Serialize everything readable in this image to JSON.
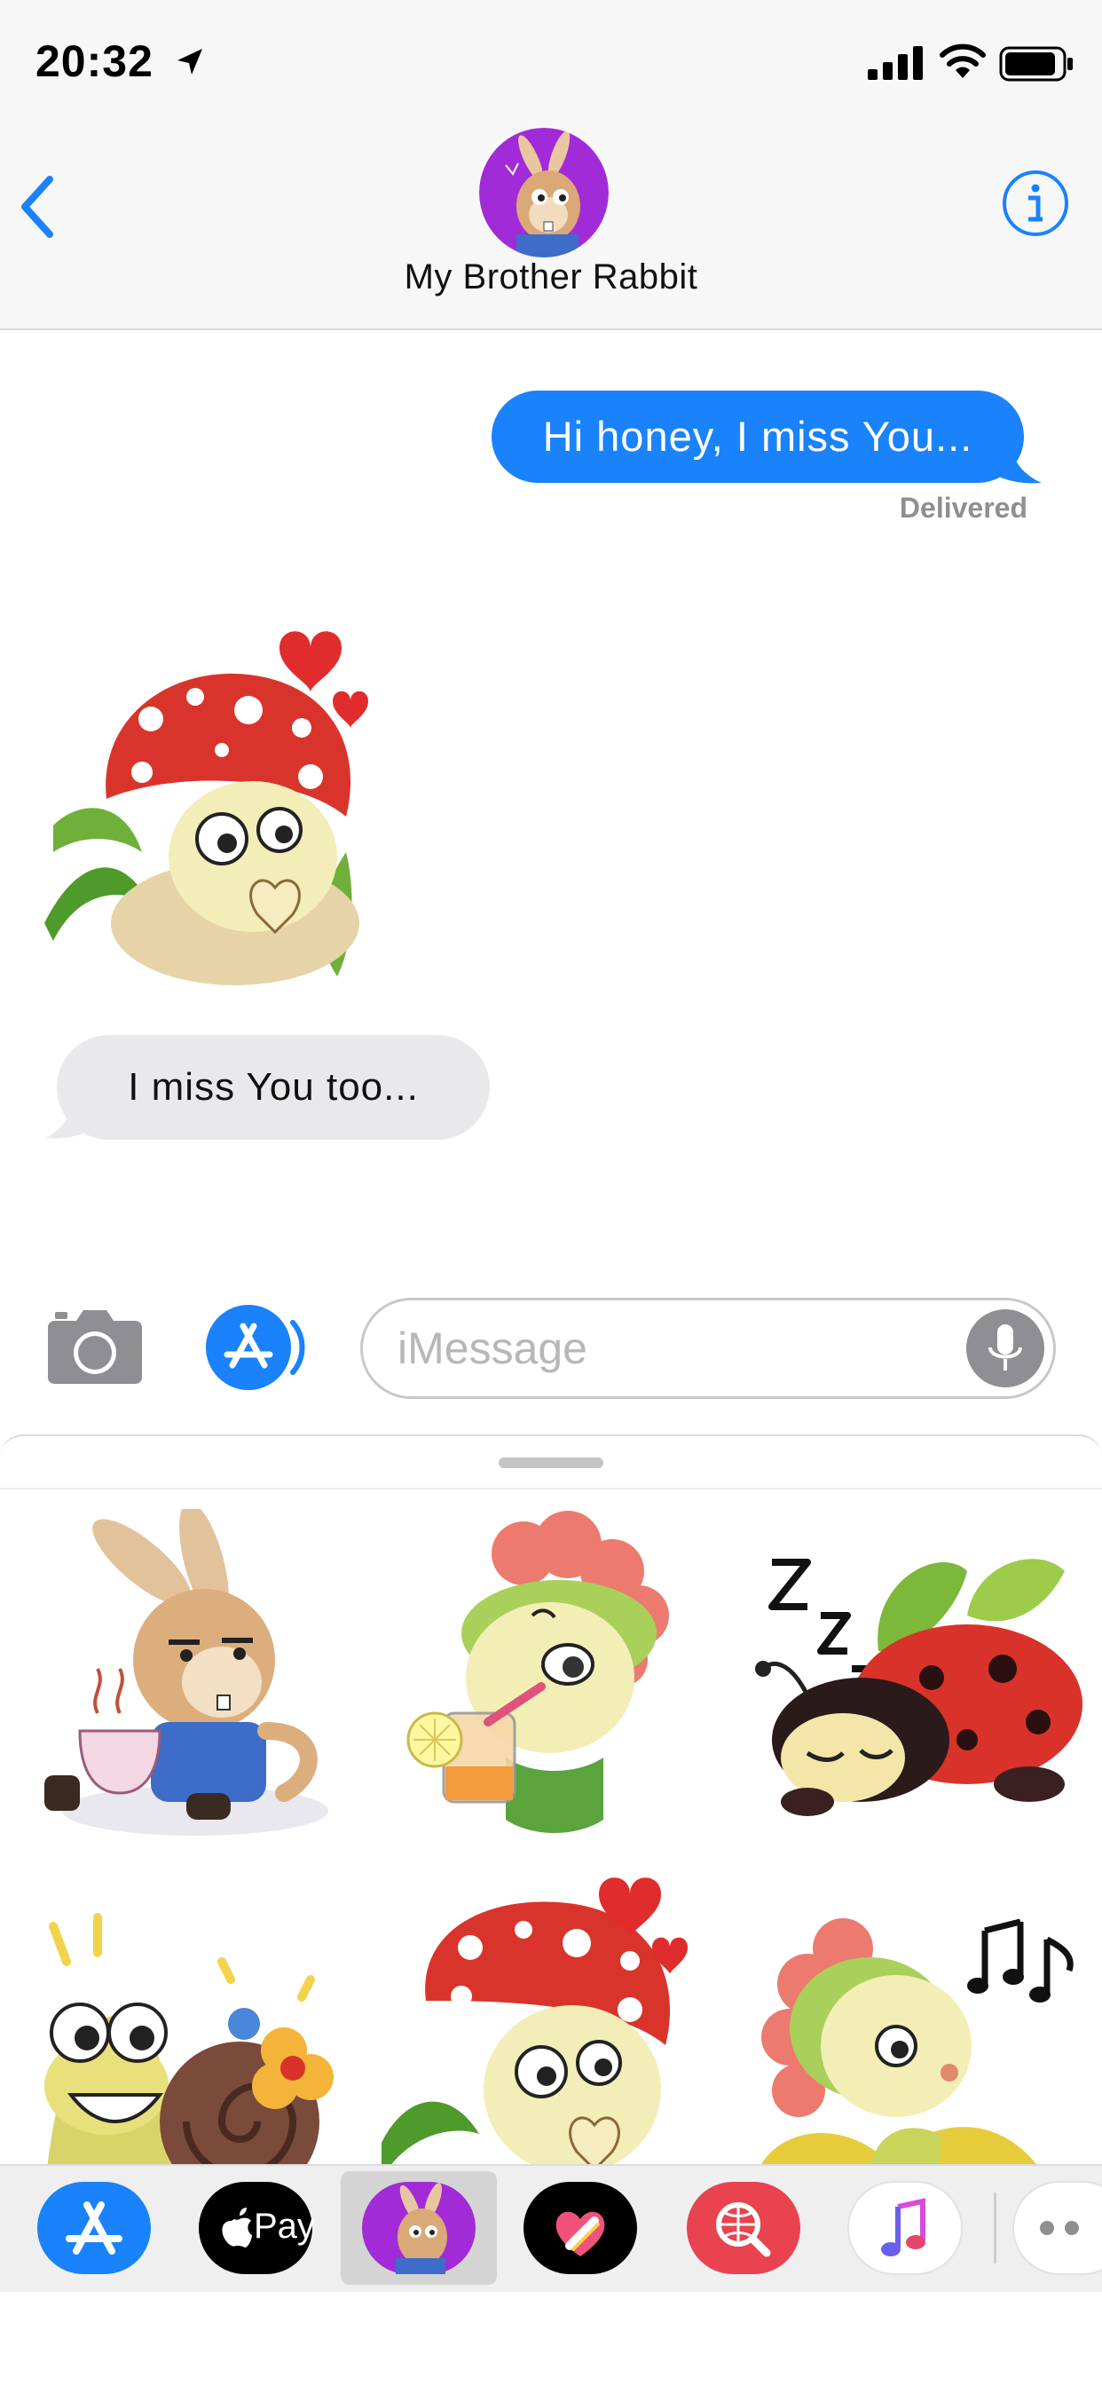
{
  "status_bar": {
    "time": "20:32"
  },
  "header": {
    "contact_name": "My Brother Rabbit"
  },
  "conversation": {
    "outgoing_message": "Hi honey, I miss You...",
    "delivery_status": "Delivered",
    "incoming_message": "I miss You too..."
  },
  "composer": {
    "placeholder": "iMessage"
  },
  "sticker_drawer": {
    "stickers": [
      {
        "name": "rabbit-tea-sticker"
      },
      {
        "name": "flower-lemonade-sticker"
      },
      {
        "name": "sleeping-ladybug-sticker"
      },
      {
        "name": "snail-flowers-sticker"
      },
      {
        "name": "mushroom-hearts-sticker"
      },
      {
        "name": "singing-flower-sticker"
      }
    ]
  },
  "app_drawer": {
    "apps": [
      "App Store",
      "Apple Pay",
      "My Brother Rabbit",
      "Digital Touch",
      "Web Search",
      "Music",
      "More"
    ],
    "apple_pay_label": "Pay",
    "selected_app": "My Brother Rabbit"
  },
  "colors": {
    "ios_blue": "#1a82fb",
    "incoming_bubble": "#e9e9eb",
    "avatar_purple": "#a22bd8"
  }
}
